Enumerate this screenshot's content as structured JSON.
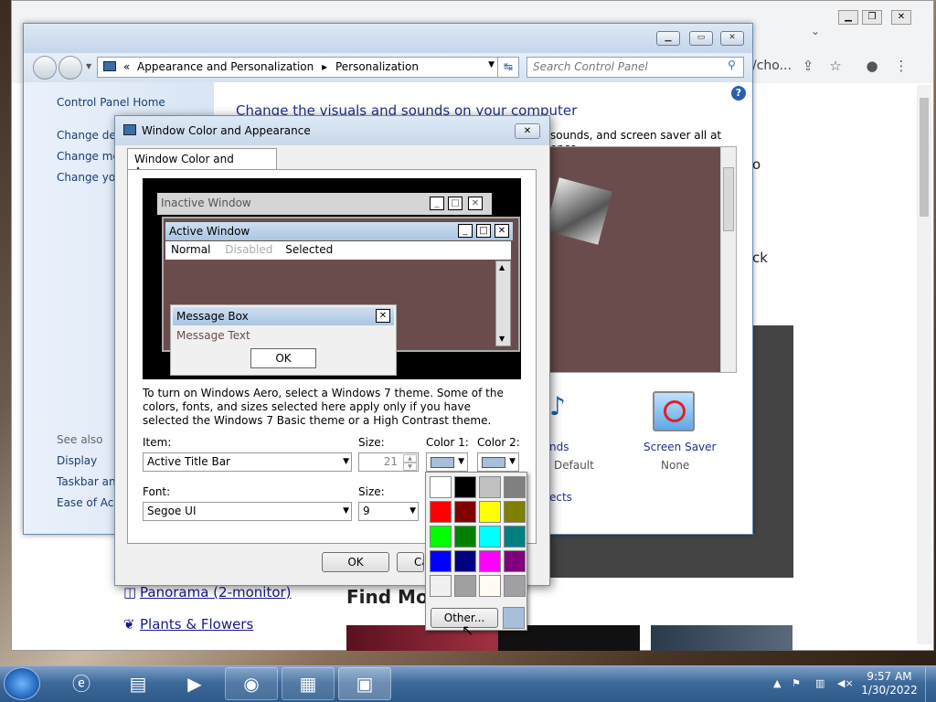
{
  "chrome": {
    "url_fragment": "/cho...",
    "page_texts": [
      "o",
      "ck"
    ],
    "find_more": "Find More",
    "links": [
      "Panorama (2-monitor)",
      "Plants & Flowers"
    ]
  },
  "control_panel": {
    "breadcrumb": {
      "sep": "«",
      "items": [
        "Appearance and Personalization",
        "Personalization"
      ],
      "arrow": "▸"
    },
    "search_placeholder": "Search Control Panel",
    "sidebar": {
      "home": "Control Panel Home",
      "links": [
        "Change des",
        "Change mo",
        "Change you"
      ],
      "see_also_title": "See also",
      "see_also": [
        "Display",
        "Taskbar and",
        "Ease of Acce"
      ]
    },
    "heading": "Change the visuals and sounds on your computer",
    "subheading_fragment": "sounds, and screen saver all at once.",
    "items": [
      {
        "label": "nds",
        "sub": "Default"
      },
      {
        "label": "Screen Saver",
        "sub": "None"
      }
    ],
    "links_fragment": "ects"
  },
  "dialog": {
    "title": "Window Color and Appearance",
    "tab": "Window Color and Appearance",
    "preview": {
      "inactive": "Inactive Window",
      "active": "Active Window",
      "menu": [
        "Normal",
        "Disabled",
        "Selected"
      ],
      "msg_title": "Message Box",
      "msg_text": "Message Text",
      "ok": "OK"
    },
    "note": "To turn on Windows Aero, select a Windows 7 theme.  Some of the colors, fonts, and sizes selected here apply only if you have selected the Windows 7 Basic theme or a High Contrast theme.",
    "item_label": "Item:",
    "item_value": "Active Title Bar",
    "size_label": "Size:",
    "size_value": "21",
    "color1_label": "Color 1:",
    "color2_label": "Color 2:",
    "font_label": "Font:",
    "font_value": "Segoe UI",
    "font_size_label": "Size:",
    "font_size_value": "9",
    "ok": "OK",
    "cancel_fragment": "Ca"
  },
  "palette": {
    "colors": [
      "#ffffff",
      "#000000",
      "#c0c0c0",
      "#808080",
      "#ff0000",
      "#800000",
      "#ffff00",
      "#808000",
      "#00ff00",
      "#008000",
      "#00ffff",
      "#008080",
      "#0000ff",
      "#000080",
      "#ff00ff",
      "#800080",
      "#f0f0f0",
      "#a0a0a0",
      "#fffbf0",
      "#a0a0a4"
    ],
    "other": "Other...",
    "current": "#a7bfda"
  },
  "taskbar": {
    "time": "9:57 AM",
    "date": "1/30/2022"
  }
}
